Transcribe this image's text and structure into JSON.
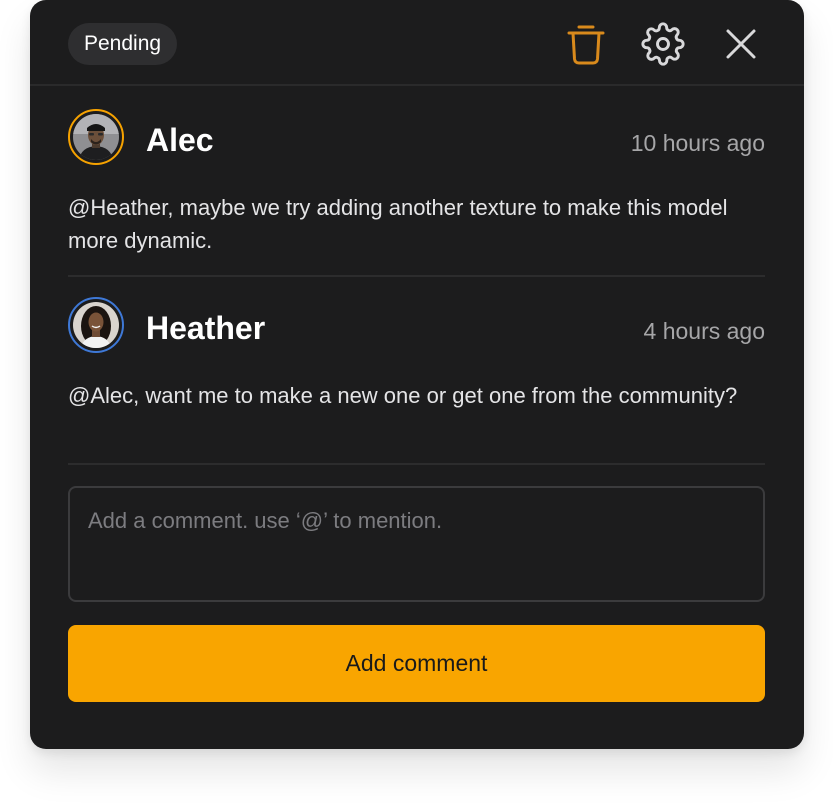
{
  "header": {
    "status_badge": "Pending",
    "icons": {
      "delete": "trash-icon",
      "settings": "gear-icon",
      "close": "close-icon"
    }
  },
  "comments": [
    {
      "author": "Alec",
      "time": "10 hours ago",
      "text": "@Heather, maybe we try adding another texture to make this model more dynamic.",
      "avatar_ring": "#f6a200"
    },
    {
      "author": "Heather",
      "time": "4 hours ago",
      "text": "@Alec, want me to make a new one or get one from the community?",
      "avatar_ring": "#3e78d6"
    }
  ],
  "composer": {
    "placeholder": "Add a comment. use ‘@’ to mention.",
    "value": "",
    "submit_label": "Add comment"
  },
  "colors": {
    "panel_bg": "#1c1c1d",
    "accent": "#f9a500",
    "trash_icon": "#d98a1c",
    "muted_text": "#a6a6a8"
  }
}
